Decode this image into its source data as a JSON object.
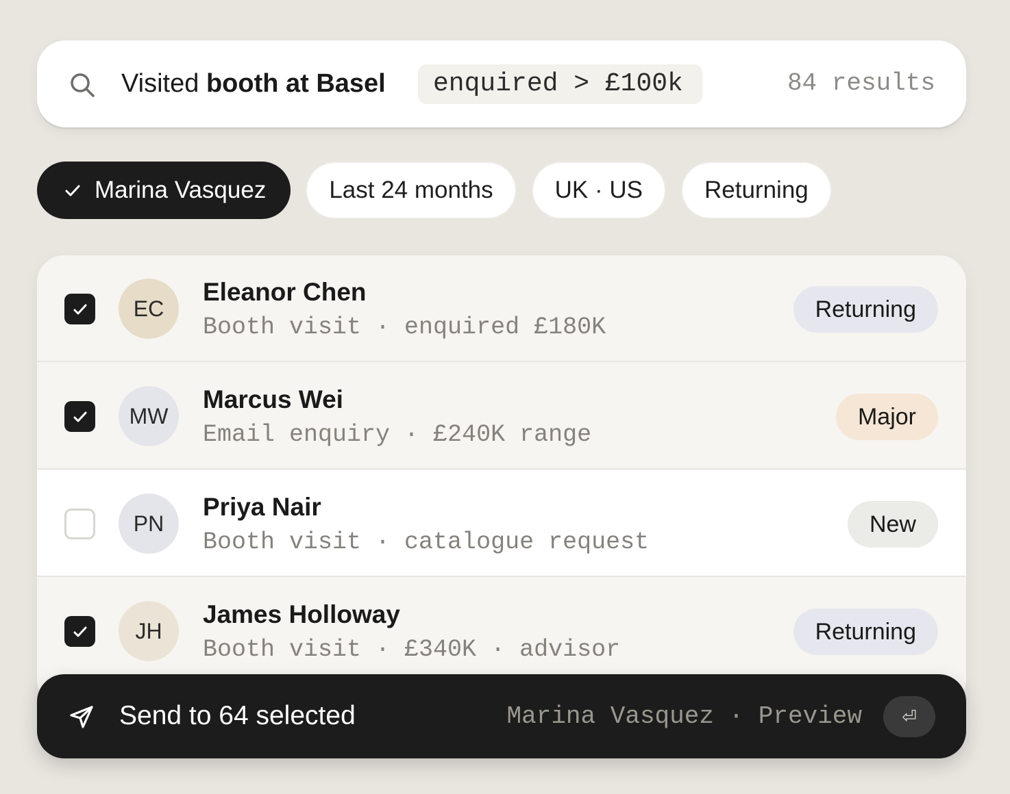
{
  "search": {
    "query_prefix": "Visited ",
    "query_bold": "booth at Basel",
    "token": "enquired > £100k",
    "results": "84 results"
  },
  "filters": [
    {
      "label": "Marina Vasquez",
      "active": true
    },
    {
      "label": "Last 24 months",
      "active": false
    },
    {
      "label": "UK · US",
      "active": false
    },
    {
      "label": "Returning",
      "active": false
    }
  ],
  "contacts": [
    {
      "initials": "EC",
      "name": "Eleanor Chen",
      "detail": "Booth visit · enquired £180K",
      "badge": "Returning",
      "checked": true,
      "avatar_color": "#e6dcc8",
      "badge_color": "#e6e7ee",
      "row_color": "#f6f5f1"
    },
    {
      "initials": "MW",
      "name": "Marcus Wei",
      "detail": "Email enquiry · £240K range",
      "badge": "Major",
      "checked": true,
      "avatar_color": "#e4e5ea",
      "badge_color": "#f6e6d6",
      "row_color": "#f6f5f1"
    },
    {
      "initials": "PN",
      "name": "Priya Nair",
      "detail": "Booth visit · catalogue request",
      "badge": "New",
      "checked": false,
      "avatar_color": "#e4e5ea",
      "badge_color": "#ebebe7",
      "row_color": "#ffffff"
    },
    {
      "initials": "JH",
      "name": "James Holloway",
      "detail": "Booth visit · £340K · advisor",
      "badge": "Returning",
      "checked": true,
      "avatar_color": "#ebe4d6",
      "badge_color": "#e6e7ee",
      "row_color": "#f6f5f1"
    }
  ],
  "action": {
    "send_label": "Send to 64 selected",
    "meta": "Marina Vasquez · Preview",
    "enter_key": "⏎"
  }
}
